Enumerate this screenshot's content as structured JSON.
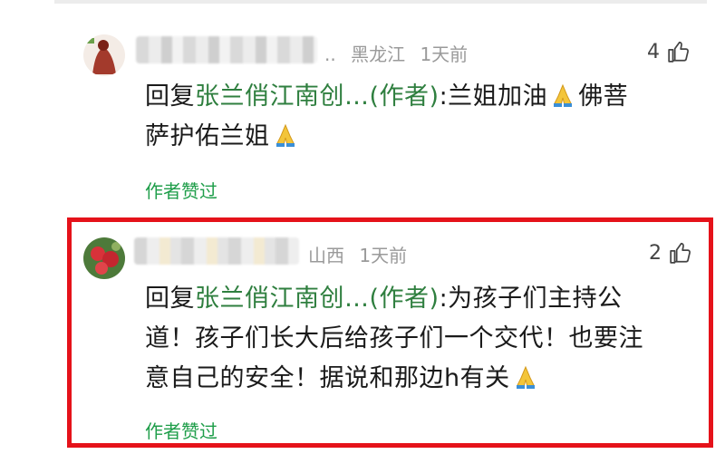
{
  "comments": [
    {
      "location": "黑龙江",
      "time": "1天前",
      "likes": "4",
      "reply_prefix": "回复",
      "reply_target": "张兰俏江南创…(作者)",
      "text_line1": ":兰姐加油",
      "text_line1b": "佛菩",
      "text_line2": "萨护佑兰姐",
      "author_liked": "作者赞过",
      "name_ellipsis": ".."
    },
    {
      "location": "山西",
      "time": "1天前",
      "likes": "2",
      "reply_prefix": "回复",
      "reply_target": "张兰俏江南创…(作者)",
      "text_line1": ":为孩子们主持公",
      "text_line2": "道！孩子们长大后给孩子们一个交代！也要注",
      "text_line3": "意自己的安全！据说和那边h有关",
      "author_liked": "作者赞过"
    }
  ],
  "colors": {
    "highlight_border": "#e5121a",
    "liked_green": "#1f9e4a",
    "meta_gray": "#9a9a9a"
  },
  "icons": [
    "thumbs-up-icon",
    "folded-hands-emoji"
  ]
}
